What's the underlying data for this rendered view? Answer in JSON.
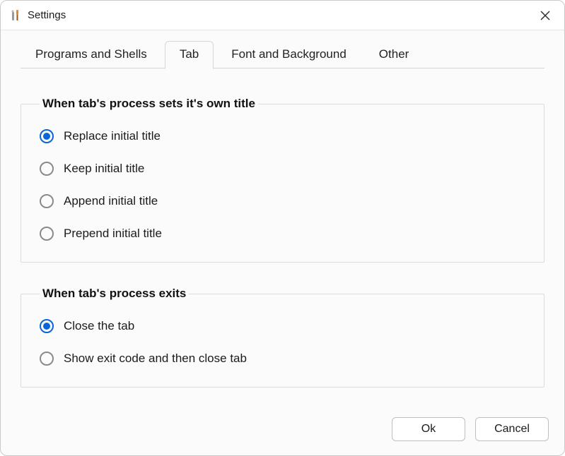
{
  "window": {
    "title": "Settings"
  },
  "tabs": [
    {
      "label": "Programs and Shells",
      "active": false
    },
    {
      "label": "Tab",
      "active": true
    },
    {
      "label": "Font and Background",
      "active": false
    },
    {
      "label": "Other",
      "active": false
    }
  ],
  "groups": {
    "title_behavior": {
      "legend": "When tab's process sets it's own title",
      "options": [
        {
          "label": "Replace initial title",
          "checked": true
        },
        {
          "label": "Keep initial title",
          "checked": false
        },
        {
          "label": "Append initial title",
          "checked": false
        },
        {
          "label": "Prepend initial title",
          "checked": false
        }
      ]
    },
    "exit_behavior": {
      "legend": "When tab's process exits",
      "options": [
        {
          "label": "Close the tab",
          "checked": true
        },
        {
          "label": "Show exit code and then close tab",
          "checked": false
        }
      ]
    }
  },
  "buttons": {
    "ok": "Ok",
    "cancel": "Cancel"
  }
}
